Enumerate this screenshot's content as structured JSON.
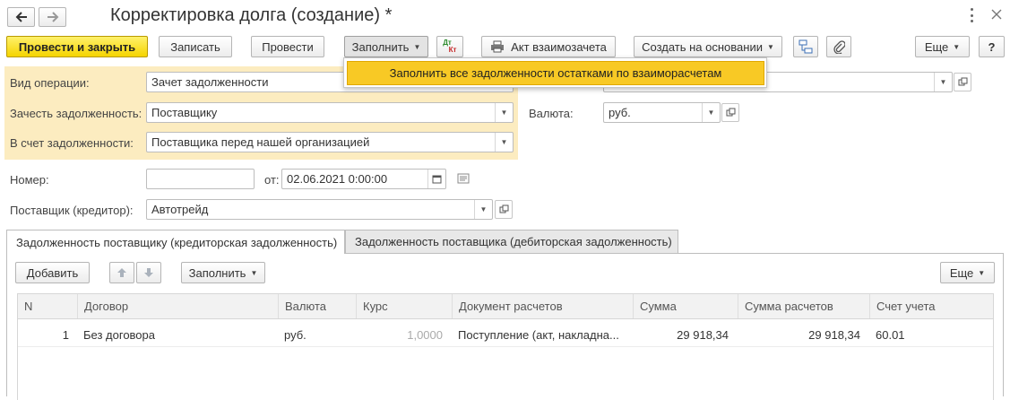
{
  "window": {
    "title": "Корректировка долга (создание) *",
    "back_icon": "arrow-left",
    "forward_icon": "arrow-right",
    "more_icon": "vertical-dots",
    "close_icon": "close-x"
  },
  "toolbar": {
    "post_close": "Провести и закрыть",
    "write": "Записать",
    "post": "Провести",
    "fill": "Заполнить",
    "dtkt_top": "Дт",
    "dtkt_bottom": "Кт",
    "mutual_act": "Акт взаимозачета",
    "create_based": "Создать на основании",
    "more": "Еще",
    "help": "?"
  },
  "fill_menu": {
    "item": "Заполнить все задолженности остатками по взаиморасчетам"
  },
  "form": {
    "operation_label": "Вид операции:",
    "operation_value": "Зачет задолженности",
    "offset_label": "Зачесть задолженность:",
    "offset_value": "Поставщику",
    "against_label": "В счет задолженности:",
    "against_value": "Поставщика перед нашей организацией",
    "currency_label": "Валюта:",
    "currency_value": "руб.",
    "number_label": "Номер:",
    "number_value": "",
    "date_from_label": "от:",
    "date_value": "02.06.2021  0:00:00",
    "supplier_label": "Поставщик (кредитор):",
    "supplier_value": "Автотрейд"
  },
  "tabs": [
    {
      "label": "Задолженность поставщику (кредиторская задолженность)",
      "active": true
    },
    {
      "label": "Задолженность поставщика (дебиторская задолженность)",
      "active": false
    }
  ],
  "table_toolbar": {
    "add": "Добавить",
    "fill": "Заполнить",
    "more": "Еще"
  },
  "table": {
    "columns": [
      "N",
      "Договор",
      "Валюта",
      "Курс",
      "Документ расчетов",
      "Сумма",
      "Сумма расчетов",
      "Счет учета"
    ],
    "rows": [
      {
        "n": "1",
        "contract": "Без договора",
        "currency": "руб.",
        "rate": "1,0000",
        "document": "Поступление (акт, накладна...",
        "sum": "29 918,34",
        "sum_calc": "29 918,34",
        "account": "60.01"
      }
    ]
  },
  "colors": {
    "accent_yellow": "#f5d400",
    "panel_highlight": "#fcecc0",
    "menu_highlight": "#f8c925"
  }
}
